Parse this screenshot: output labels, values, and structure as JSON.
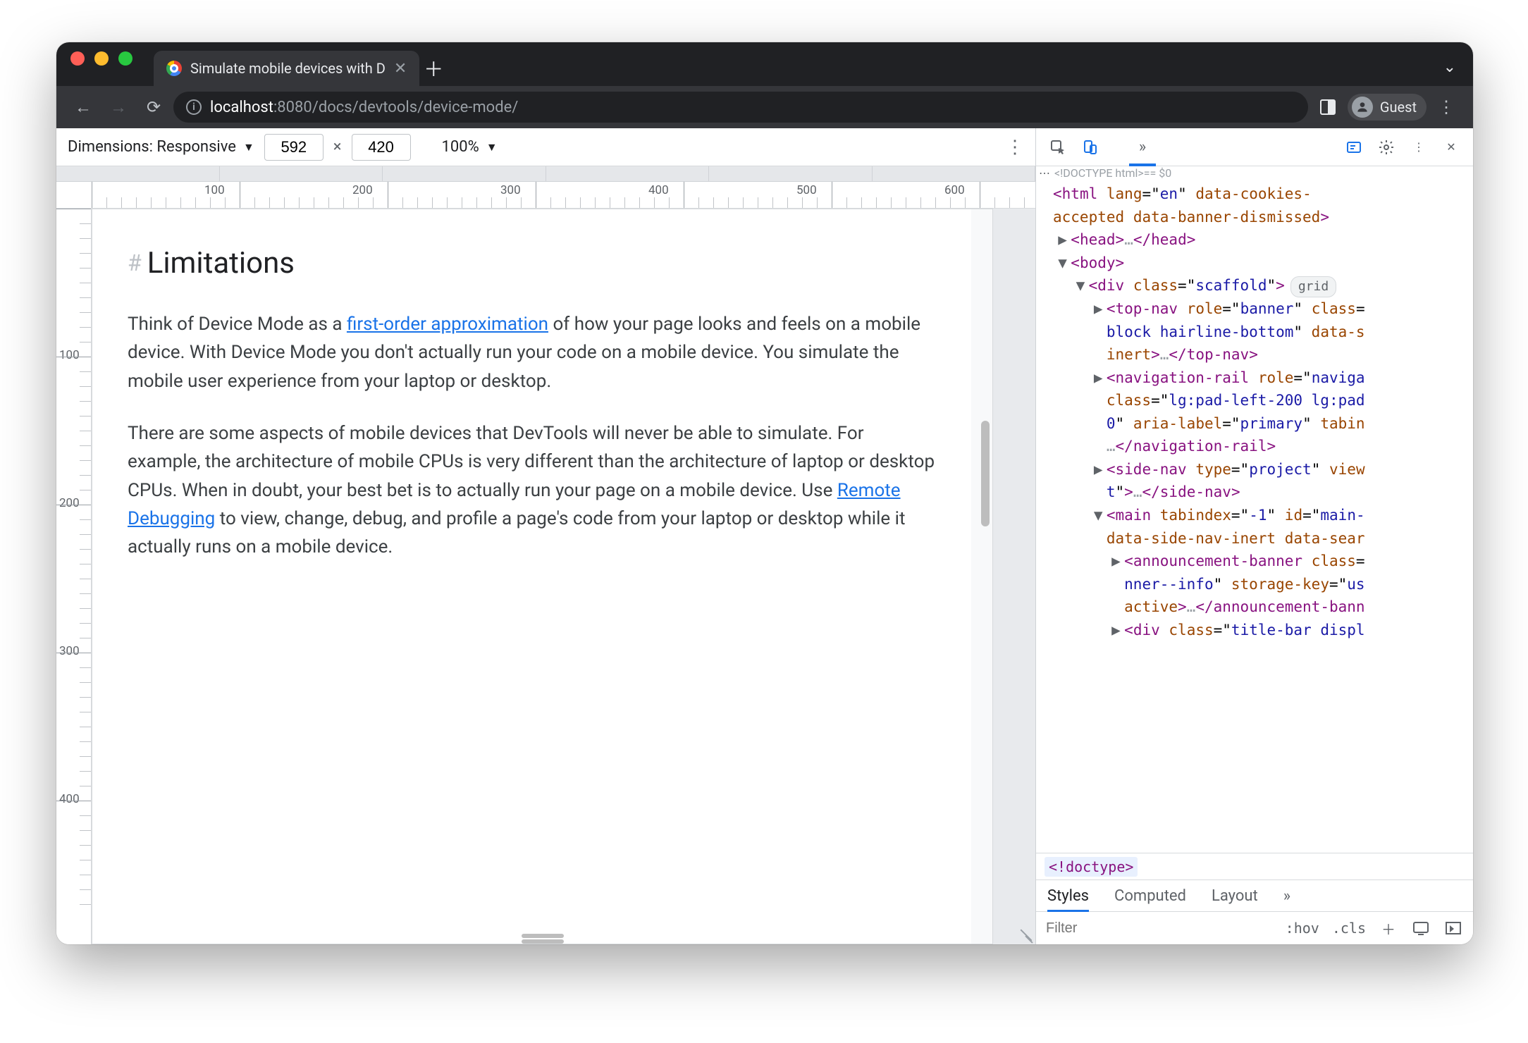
{
  "browser": {
    "tab_title": "Simulate mobile devices with D",
    "url_host": "localhost",
    "url_rest": ":8080/docs/devtools/device-mode/",
    "guest_label": "Guest"
  },
  "device_toolbar": {
    "dimensions_label": "Dimensions: Responsive",
    "width": "592",
    "height": "420",
    "multiply": "×",
    "zoom": "100%"
  },
  "ruler": {
    "hticks": [
      "100",
      "200",
      "300",
      "400",
      "500",
      "600"
    ],
    "vticks": [
      "100",
      "200",
      "300",
      "400"
    ]
  },
  "page": {
    "heading": "Limitations",
    "p1_a": "Think of Device Mode as a ",
    "p1_link": "first-order approximation",
    "p1_b": " of how your page looks and feels on a mobile device. With Device Mode you don't actually run your code on a mobile device. You simulate the mobile user experience from your laptop or desktop.",
    "p2_a": "There are some aspects of mobile devices that DevTools will never be able to simulate. For example, the architecture of mobile CPUs is very different than the architecture of laptop or desktop CPUs. When in doubt, your best bet is to actually run your page on a mobile device. Use ",
    "p2_link": "Remote Debugging",
    "p2_b": " to view, change, debug, and profile a page's code from your laptop or desktop while it actually runs on a mobile device."
  },
  "devtools": {
    "doctype": "<!DOCTYPE html>",
    "eq0": " == $0",
    "grid_pill": "grid",
    "lines": [
      {
        "ind": 0,
        "arrow": "",
        "html": "<span class='punc'>&lt;</span><span class='tag'>html</span> <span class='attr'>lang</span>=\"<span class='val'>en</span>\" <span class='attr'>data-cookies-</span>"
      },
      {
        "ind": 0,
        "arrow": "",
        "html": "<span class='attr'>accepted</span> <span class='attr'>data-banner-dismissed</span><span class='punc'>&gt;</span>"
      },
      {
        "ind": 1,
        "arrow": "▶",
        "html": "<span class='punc'>&lt;</span><span class='tag'>head</span><span class='punc'>&gt;</span><span class='dots'>…</span><span class='punc'>&lt;/</span><span class='tag'>head</span><span class='punc'>&gt;</span>"
      },
      {
        "ind": 1,
        "arrow": "▼",
        "html": "<span class='punc'>&lt;</span><span class='tag'>body</span><span class='punc'>&gt;</span>"
      },
      {
        "ind": 2,
        "arrow": "▼",
        "html": "<span class='punc'>&lt;</span><span class='tag'>div</span> <span class='attr'>class</span>=\"<span class='val'>scaffold</span>\"<span class='punc'>&gt;</span><span class='pill'>grid</span>"
      },
      {
        "ind": 3,
        "arrow": "▶",
        "html": "<span class='punc'>&lt;</span><span class='tag'>top-nav</span> <span class='attr'>role</span>=\"<span class='val'>banner</span>\" <span class='attr'>class</span>="
      },
      {
        "ind": 3,
        "arrow": "",
        "html": "<span class='val'>block hairline-bottom</span>\" <span class='attr'>data-s</span>"
      },
      {
        "ind": 3,
        "arrow": "",
        "html": "<span class='attr'>inert</span><span class='punc'>&gt;</span><span class='dots'>…</span><span class='punc'>&lt;/</span><span class='tag'>top-nav</span><span class='punc'>&gt;</span>"
      },
      {
        "ind": 3,
        "arrow": "▶",
        "html": "<span class='punc'>&lt;</span><span class='tag'>navigation-rail</span> <span class='attr'>role</span>=\"<span class='val'>naviga</span>"
      },
      {
        "ind": 3,
        "arrow": "",
        "html": "<span class='attr'>class</span>=\"<span class='val'>lg:pad-left-200 lg:pad</span>"
      },
      {
        "ind": 3,
        "arrow": "",
        "html": "<span class='val'>0</span>\" <span class='attr'>aria-label</span>=\"<span class='val'>primary</span>\" <span class='attr'>tabin</span>"
      },
      {
        "ind": 3,
        "arrow": "",
        "html": "<span class='dots'>…</span><span class='punc'>&lt;/</span><span class='tag'>navigation-rail</span><span class='punc'>&gt;</span>"
      },
      {
        "ind": 3,
        "arrow": "▶",
        "html": "<span class='punc'>&lt;</span><span class='tag'>side-nav</span> <span class='attr'>type</span>=\"<span class='val'>project</span>\" <span class='attr'>view</span>"
      },
      {
        "ind": 3,
        "arrow": "",
        "html": "<span class='val'>t</span>\"<span class='punc'>&gt;</span><span class='dots'>…</span><span class='punc'>&lt;/</span><span class='tag'>side-nav</span><span class='punc'>&gt;</span>"
      },
      {
        "ind": 3,
        "arrow": "▼",
        "html": "<span class='punc'>&lt;</span><span class='tag'>main</span> <span class='attr'>tabindex</span>=\"<span class='val'>-1</span>\" <span class='attr'>id</span>=\"<span class='val'>main-</span>"
      },
      {
        "ind": 3,
        "arrow": "",
        "html": "<span class='attr'>data-side-nav-inert</span> <span class='attr'>data-sear</span>"
      },
      {
        "ind": 4,
        "arrow": "▶",
        "html": "<span class='punc'>&lt;</span><span class='tag'>announcement-banner</span> <span class='attr'>class</span>="
      },
      {
        "ind": 4,
        "arrow": "",
        "html": "<span class='val'>nner--info</span>\" <span class='attr'>storage-key</span>=\"<span class='val'>us</span>"
      },
      {
        "ind": 4,
        "arrow": "",
        "html": "<span class='attr'>active</span><span class='punc'>&gt;</span><span class='dots'>…</span><span class='punc'>&lt;/</span><span class='tag'>announcement-bann</span>"
      },
      {
        "ind": 4,
        "arrow": "▶",
        "html": "<span class='punc'>&lt;</span><span class='tag'>div</span> <span class='attr'>class</span>=\"<span class='val'>title-bar displ</span>"
      }
    ],
    "breadcrumb": "<!doctype>",
    "styles_tabs": {
      "styles": "Styles",
      "computed": "Computed",
      "layout": "Layout"
    },
    "filter_placeholder": "Filter",
    "hov": ":hov",
    "cls": ".cls"
  }
}
